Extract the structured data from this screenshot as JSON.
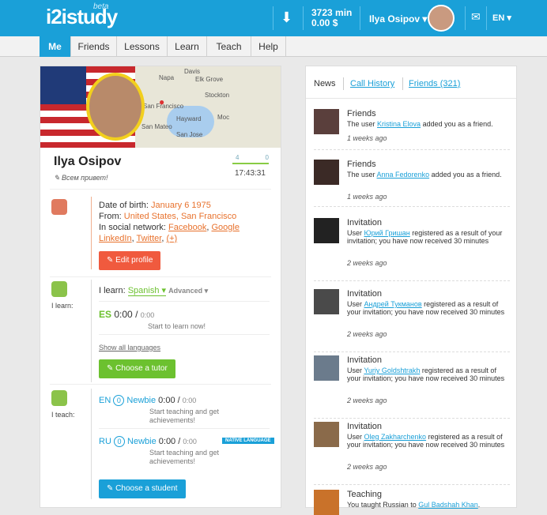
{
  "header": {
    "logo": "i2istudy",
    "beta": "beta",
    "balance_minutes": "3723 min",
    "balance_money": "0.00 $",
    "user_name": "Ilya Osipov ▾",
    "language": "EN ▾"
  },
  "nav": {
    "tabs": [
      {
        "label": "Me"
      },
      {
        "label": "Friends"
      },
      {
        "label": "Lessons"
      },
      {
        "label": "Learn"
      },
      {
        "label": "Teach"
      },
      {
        "label": "Help"
      }
    ]
  },
  "profile": {
    "name": "Ilya Osipov",
    "greeting": "Всем привет!",
    "count_left": "4",
    "count_right": "0",
    "time": "17:43:31",
    "map_labels": [
      "Davis",
      "Napa",
      "Elk Grove",
      "Stockton",
      "San Francisco",
      "Hayward",
      "San Mateo",
      "San Jose",
      "Moc"
    ],
    "dob_label": "Date of birth:",
    "dob_value": "January 6 1975",
    "from_label": "From:",
    "from_value": "United States, San Francisco",
    "social_label": "In social network:",
    "social_links": [
      "Facebook",
      "Google",
      "LinkedIn",
      "Twitter",
      "(+)"
    ],
    "edit_button": "Edit profile"
  },
  "learn": {
    "section_label": "I learn:",
    "title_prefix": "I learn:",
    "language": "Spanish ▾",
    "level": "Advanced ▾",
    "lang_code": "ES",
    "time": "0:00",
    "slash": "/",
    "time_total": "0:00",
    "hint": "Start to learn now!",
    "show_all": "Show all languages",
    "button": "Choose a tutor"
  },
  "teach": {
    "section_label": "I teach:",
    "rows": [
      {
        "code": "EN",
        "level": "Newbie",
        "badge": "0",
        "time": "0:00",
        "time_total": "0:00",
        "hint1": "Start teaching and get",
        "hint2": "achievements!",
        "native": ""
      },
      {
        "code": "RU",
        "level": "Newbie",
        "badge": "0",
        "time": "0:00",
        "time_total": "0:00",
        "hint1": "Start teaching and get",
        "hint2": "achievements!",
        "native": "NATIVE LANGUAGE"
      }
    ],
    "button": "Choose a student"
  },
  "feed": {
    "tabs": [
      "News",
      "Call History",
      "Friends (321)"
    ],
    "items": [
      {
        "title": "Friends",
        "pre": "The user ",
        "user": "Kristina Elova",
        "post": " added you as a friend.",
        "time": "1 weeks ago"
      },
      {
        "title": "Friends",
        "pre": "The user ",
        "user": "Anna Fedorenko",
        "post": " added you as a friend.",
        "time": "1 weeks ago"
      },
      {
        "title": "Invitation",
        "pre": "User ",
        "user": "Юрий Гришан",
        "post": " registered as a result of your invitation; you have now received 30 minutes",
        "time": "2 weeks ago"
      },
      {
        "title": "Invitation",
        "pre": "User ",
        "user": "Андрей Тукманов",
        "post": " registered as a result of your invitation; you have now received 30 minutes",
        "time": "2 weeks ago"
      },
      {
        "title": "Invitation",
        "pre": "User ",
        "user": "Yuriy Goldshtrakh",
        "post": " registered as a result of your invitation; you have now received 30 minutes",
        "time": "2 weeks ago"
      },
      {
        "title": "Invitation",
        "pre": "User ",
        "user": "Oleg Zakharchenko",
        "post": " registered as a result of your invitation; you have now received 30 minutes",
        "time": "2 weeks ago"
      },
      {
        "title": "Teaching",
        "pre": "You taught Russian to ",
        "user": "Gul Badshah Khan",
        "post": ".",
        "time": ""
      }
    ]
  }
}
